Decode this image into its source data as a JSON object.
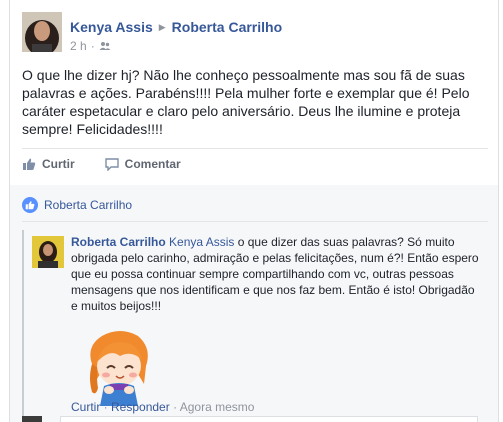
{
  "post": {
    "author": "Kenya Assis",
    "recipient": "Roberta Carrilho",
    "time": "2 h",
    "text": "O que lhe dizer hj? Não lhe conheço pessoalmente mas sou fã de suas palavras e ações. Parabéns!!!! Pela mulher forte e exemplar que é! Pelo caráter espetacular e claro pelo aniversário. Deus lhe ilumine e proteja sempre! Felicidades!!!!"
  },
  "actions": {
    "like": "Curtir",
    "comment": "Comentar"
  },
  "likes": {
    "name": "Roberta Carrilho"
  },
  "comment": {
    "author": "Roberta Carrilho",
    "tagged": "Kenya Assis",
    "text": " o que dizer das suas palavras? Só muito obrigada pelo carinho, admiração e pelas felicitações, num é?! Então espero que eu possa continuar sempre compartilhando com vc, outras pessoas mensagens que nos identificam e que nos faz bem. Então é isto! Obrigadão e muitos beijos!!!",
    "like": "Curtir",
    "reply": "Responder",
    "time": "Agora mesmo",
    "separator": " · "
  },
  "colors": {
    "link": "#365899",
    "meta": "#90949c",
    "like_badge": "#5890ff"
  }
}
